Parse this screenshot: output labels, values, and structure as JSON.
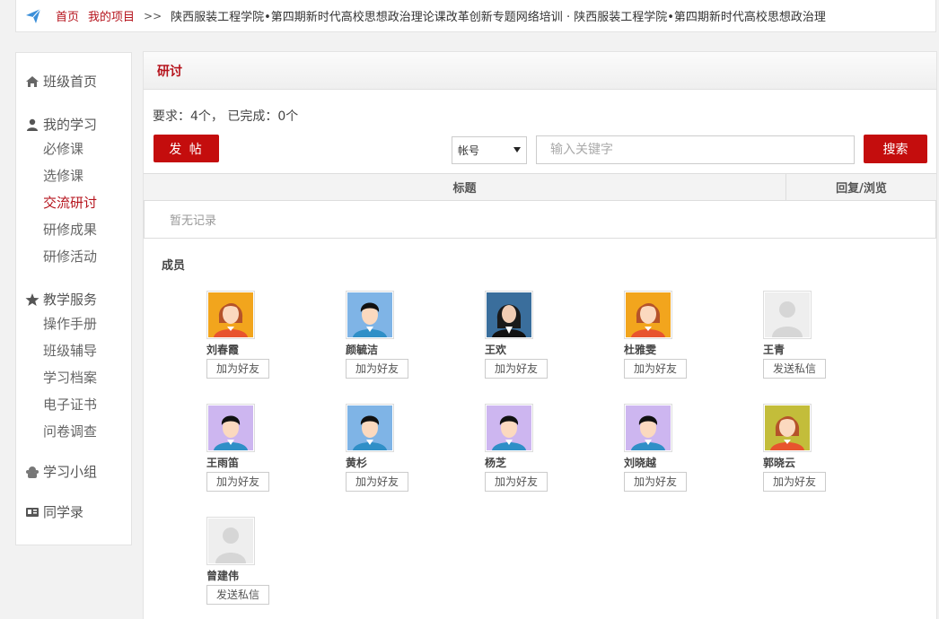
{
  "breadcrumb": {
    "home": "首页",
    "projects": "我的项目",
    "sep": ">>",
    "path": "陕西服装工程学院•第四期新时代高校思想政治理论课改革创新专题网络培训 · 陕西服装工程学院•第四期新时代高校思想政治理"
  },
  "sidebar": {
    "class_home": "班级首页",
    "my_learning": "我的学习",
    "learning_items": [
      "必修课",
      "选修课",
      "交流研讨",
      "研修成果",
      "研修活动"
    ],
    "teaching_service": "教学服务",
    "service_items": [
      "操作手册",
      "班级辅导",
      "学习档案",
      "电子证书",
      "问卷调查"
    ],
    "study_group": "学习小组",
    "classmates": "同学录"
  },
  "panel": {
    "title": "研讨",
    "requirement": "要求：4个， 已完成：0个",
    "post_button": "发 帖",
    "select_value": "帐号",
    "search_placeholder": "输入关键字",
    "search_button": "搜索",
    "col_title": "标题",
    "col_reply": "回复/浏览",
    "empty": "暂无记录",
    "members_label": "成员"
  },
  "members": [
    {
      "name": "刘春霞",
      "action": "加为好友",
      "avatar": "female-avatar",
      "bg": "#f2a51d"
    },
    {
      "name": "颜毓洁",
      "action": "加为好友",
      "avatar": "male-avatar",
      "bg": "#7fb4e6"
    },
    {
      "name": "王欢",
      "action": "加为好友",
      "avatar": "photo-avatar",
      "bg": "#3a6e9c"
    },
    {
      "name": "杜雅雯",
      "action": "加为好友",
      "avatar": "female-avatar",
      "bg": "#f2a51d"
    },
    {
      "name": "王青",
      "action": "发送私信",
      "avatar": "default-avatar",
      "bg": "#eeeeee"
    },
    {
      "name": "王雨笛",
      "action": "加为好友",
      "avatar": "male-avatar",
      "bg": "#cdb6f0"
    },
    {
      "name": "黄杉",
      "action": "加为好友",
      "avatar": "male-avatar",
      "bg": "#7fb4e6"
    },
    {
      "name": "杨芝",
      "action": "加为好友",
      "avatar": "male-avatar",
      "bg": "#cdb6f0"
    },
    {
      "name": "刘晓越",
      "action": "加为好友",
      "avatar": "male-avatar",
      "bg": "#cdb6f0"
    },
    {
      "name": "郭晓云",
      "action": "加为好友",
      "avatar": "female-avatar",
      "bg": "#c3bd3a"
    },
    {
      "name": "曾建伟",
      "action": "发送私信",
      "avatar": "default-avatar",
      "bg": "#eeeeee"
    }
  ]
}
